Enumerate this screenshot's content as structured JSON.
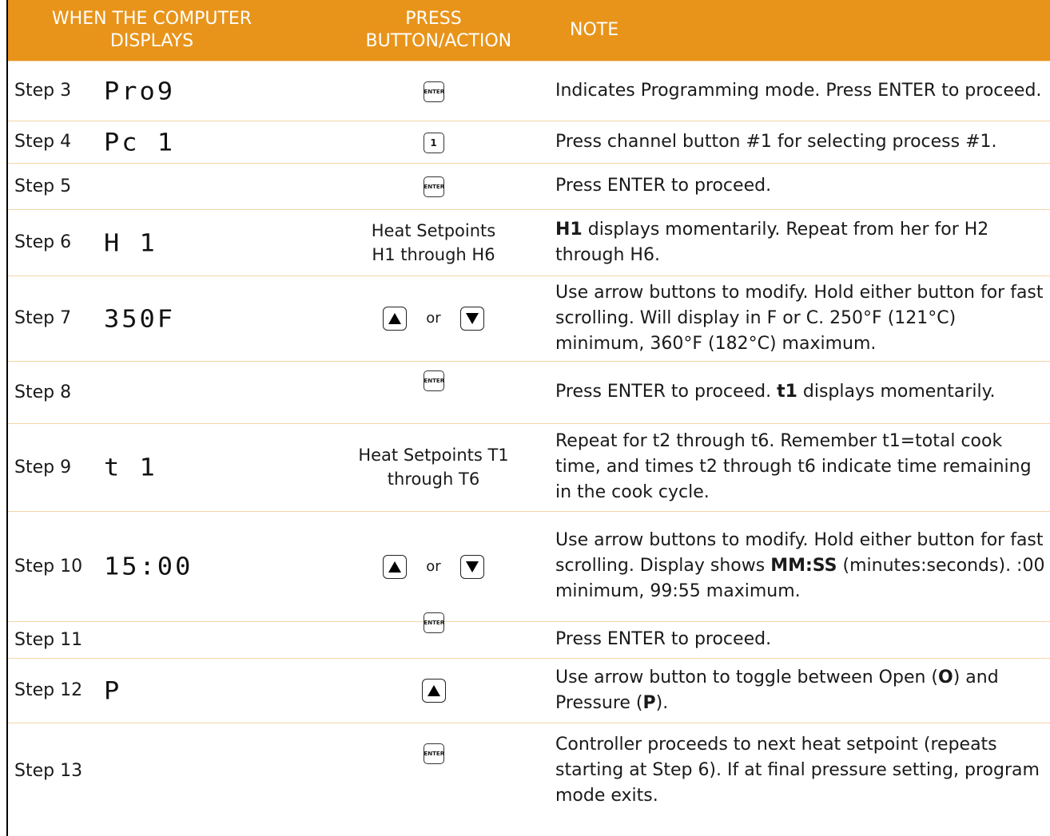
{
  "header": {
    "col1": "WHEN THE COMPUTER DISPLAYS",
    "col2": "PRESS BUTTON/ACTION",
    "col3": "NOTE"
  },
  "keys": {
    "enter": "ENTER",
    "one": "1",
    "or": "or"
  },
  "rows": [
    {
      "step": "Step 3",
      "display": "Pro9",
      "note": "Indicates Programming mode. Press ENTER to proceed."
    },
    {
      "step": "Step 4",
      "display": "Pc 1",
      "note": "Press channel button #1 for selecting process #1."
    },
    {
      "step": "Step 5",
      "display": "",
      "note": "Press ENTER to proceed."
    },
    {
      "step": "Step 6",
      "display": "H 1",
      "action": "Heat Setpoints H1 through H6",
      "note_bold": "H1",
      "note": " displays momentarily. Repeat from her for H2 through H6."
    },
    {
      "step": "Step 7",
      "display": "350F",
      "note": "Use arrow buttons to modify. Hold either button for fast scrolling. Will display in F or C. 250°F (121°C) minimum, 360°F (182°C) maximum."
    },
    {
      "step": "Step 8",
      "display": "",
      "note": "Press ENTER to proceed. ",
      "note_bold": "t1",
      "note_after": " displays momentarily."
    },
    {
      "step": "Step 9",
      "display": "t 1",
      "action": "Heat Setpoints T1 through T6",
      "note": "Repeat for t2 through t6. Remember t1=total cook time, and times t2 through t6 indicate time remaining in the cook cycle."
    },
    {
      "step": "Step 10",
      "display": "15:00",
      "note": "Use arrow buttons to modify. Hold either button for fast scrolling. Display shows ",
      "note_bold": "MM:SS",
      "note_after": " (minutes:seconds). :00 minimum, 99:55 maximum."
    },
    {
      "step": "Step 11",
      "display": "",
      "note": "Press ENTER to proceed."
    },
    {
      "step": "Step 12",
      "display": "P",
      "note": "Use arrow button to toggle between Open (",
      "note_bold": "O",
      "note_mid": ") and Pressure (",
      "note_bold2": "P",
      "note_after": ")."
    },
    {
      "step": "Step 13",
      "display": "",
      "note": "Controller proceeds to next heat setpoint (repeats starting at Step 6). If at final pressure setting, program mode exits."
    }
  ]
}
